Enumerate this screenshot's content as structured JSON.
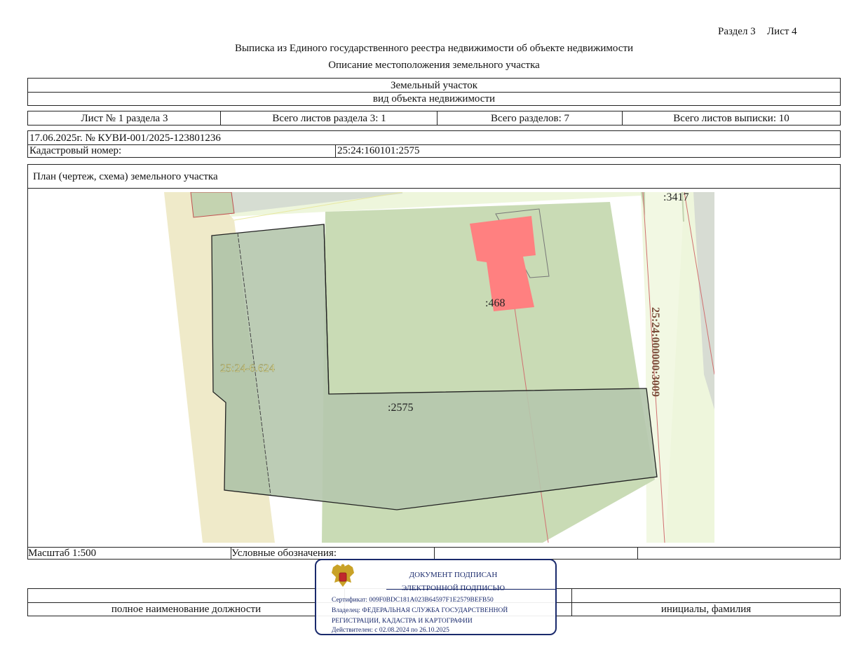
{
  "header": {
    "section": "Раздел 3",
    "sheet": "Лист 4",
    "title": "Выписка из Единого государственного реестра недвижимости об объекте недвижимости",
    "subtitle": "Описание местоположения земельного участка"
  },
  "object": {
    "type": "Земельный участок",
    "type_caption": "вид объекта недвижимости"
  },
  "sheet_info": {
    "sheet_of_section": "Лист № 1 раздела 3",
    "total_sheets_section": "Всего листов раздела 3: 1",
    "total_sections": "Всего разделов: 7",
    "total_sheets": "Всего листов выписки: 10"
  },
  "record": {
    "date_number": "17.06.2025г. № КУВИ-001/2025-123801236",
    "cadastral_label": "Кадастровый номер:",
    "cadastral_value": "25:24:160101:2575"
  },
  "plan": {
    "title": "План (чертеж, схема) земельного участка",
    "labels": {
      "parcel_3417": ":3417",
      "parcel_468": ":468",
      "parcel_624": "25:24-6.624",
      "parcel_2575": ":2575",
      "parcel_3009": "25:24:000000:3009"
    }
  },
  "legend": {
    "scale": "Масштаб 1:500",
    "symbols_label": "Условные обозначения:"
  },
  "signature": {
    "position_caption": "полное наименование должности",
    "name_caption": "инициалы, фамилия"
  },
  "stamp": {
    "line1": "ДОКУМЕНТ ПОДПИСАН",
    "line2": "ЭЛЕКТРОННОЙ ПОДПИСЬЮ",
    "certificate": "Сертификат: 009F0BDC181A023B64597F1E2579BEFB50",
    "owner1": "Владелец: ФЕДЕРАЛЬНАЯ СЛУЖБА ГОСУДАРСТВЕННОЙ",
    "owner2": "РЕГИСТРАЦИИ, КАДАСТРА И КАРТОГРАФИИ",
    "valid": "Действителен: с 02.08.2024 по 26.10.2025"
  },
  "colors": {
    "border": "#222222",
    "parcel_fill": "#b5c7ad",
    "building_fill": "#ff8080",
    "road_fill": "#f0ecc8",
    "light_green": "#eef6dc",
    "stamp": "#1a2a6c"
  }
}
